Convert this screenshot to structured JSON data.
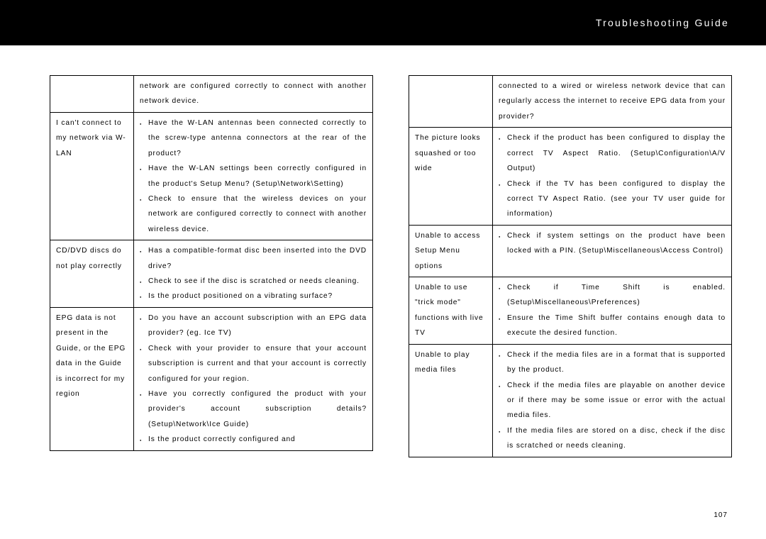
{
  "header": {
    "title": "Troubleshooting Guide"
  },
  "page_number": "107",
  "left": {
    "row0": {
      "issue": "",
      "solution_plain": "network are configured correctly to connect with another network device."
    },
    "row1": {
      "issue": "I can't connect to my network via W-LAN",
      "b1": "Have the W-LAN antennas been connected correctly to the screw-type antenna connectors at the rear of the product?",
      "b2": "Have the W-LAN settings been correctly configured in the product's Setup Menu? (Setup\\Network\\Setting)",
      "b3": "Check to ensure that the wireless devices on your network are configured correctly to connect with another wireless device."
    },
    "row2": {
      "issue": "CD/DVD discs do not play correctly",
      "b1": "Has a compatible-format disc been inserted into the DVD drive?",
      "b2": "Check to see if the disc is scratched or needs cleaning.",
      "b3": "Is the product positioned on a vibrating surface?"
    },
    "row3": {
      "issue": "EPG data is not present in the Guide, or the EPG data in the Guide is incorrect for my region",
      "b1": "Do you have an account subscription with an EPG data provider? (eg. Ice TV)",
      "b2": "Check with your provider to ensure that your account subscription is current and that your account is correctly configured for your region.",
      "b3": "Have you correctly configured the product with your provider's account subscription details? (Setup\\Network\\Ice Guide)",
      "b4": "Is the product correctly configured and"
    }
  },
  "right": {
    "row0": {
      "issue": "",
      "solution_plain": "connected to a wired or wireless network device that can regularly access the internet to receive EPG data from your provider?"
    },
    "row1": {
      "issue": "The picture looks squashed or too wide",
      "b1": "Check if the product has been configured to display the correct TV Aspect Ratio. (Setup\\Configuration\\A/V Output)",
      "b2": "Check if the TV has been configured to display the correct TV Aspect Ratio. (see your TV user guide for information)"
    },
    "row2": {
      "issue": "Unable to access Setup Menu options",
      "b1": "Check if system settings on the product have been locked with a PIN. (Setup\\Miscellaneous\\Access Control)"
    },
    "row3": {
      "issue": "Unable to use \"trick mode\" functions with live TV",
      "b1": "Check if Time Shift is enabled. (Setup\\Miscellaneous\\Preferences)",
      "b2": "Ensure the Time Shift buffer contains enough data to execute the desired function."
    },
    "row4": {
      "issue": "Unable to play media files",
      "b1": "Check if the media files are in a format that is supported by the product.",
      "b2": "Check if the media files are playable on another device or if there may be some issue or error with the actual media files.",
      "b3": "If the media files are stored on a disc, check if the disc is scratched or needs cleaning."
    }
  }
}
